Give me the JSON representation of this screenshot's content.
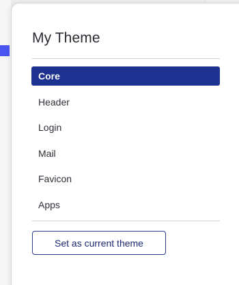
{
  "panel": {
    "title": "My Theme",
    "menu": [
      {
        "label": "Core",
        "active": true
      },
      {
        "label": "Header",
        "active": false
      },
      {
        "label": "Login",
        "active": false
      },
      {
        "label": "Mail",
        "active": false
      },
      {
        "label": "Favicon",
        "active": false
      },
      {
        "label": "Apps",
        "active": false
      }
    ],
    "action_button_label": "Set as current theme"
  },
  "colors": {
    "accent": "#1c3190",
    "button_border": "#2a3b94",
    "background_accent": "#4b55f2"
  }
}
